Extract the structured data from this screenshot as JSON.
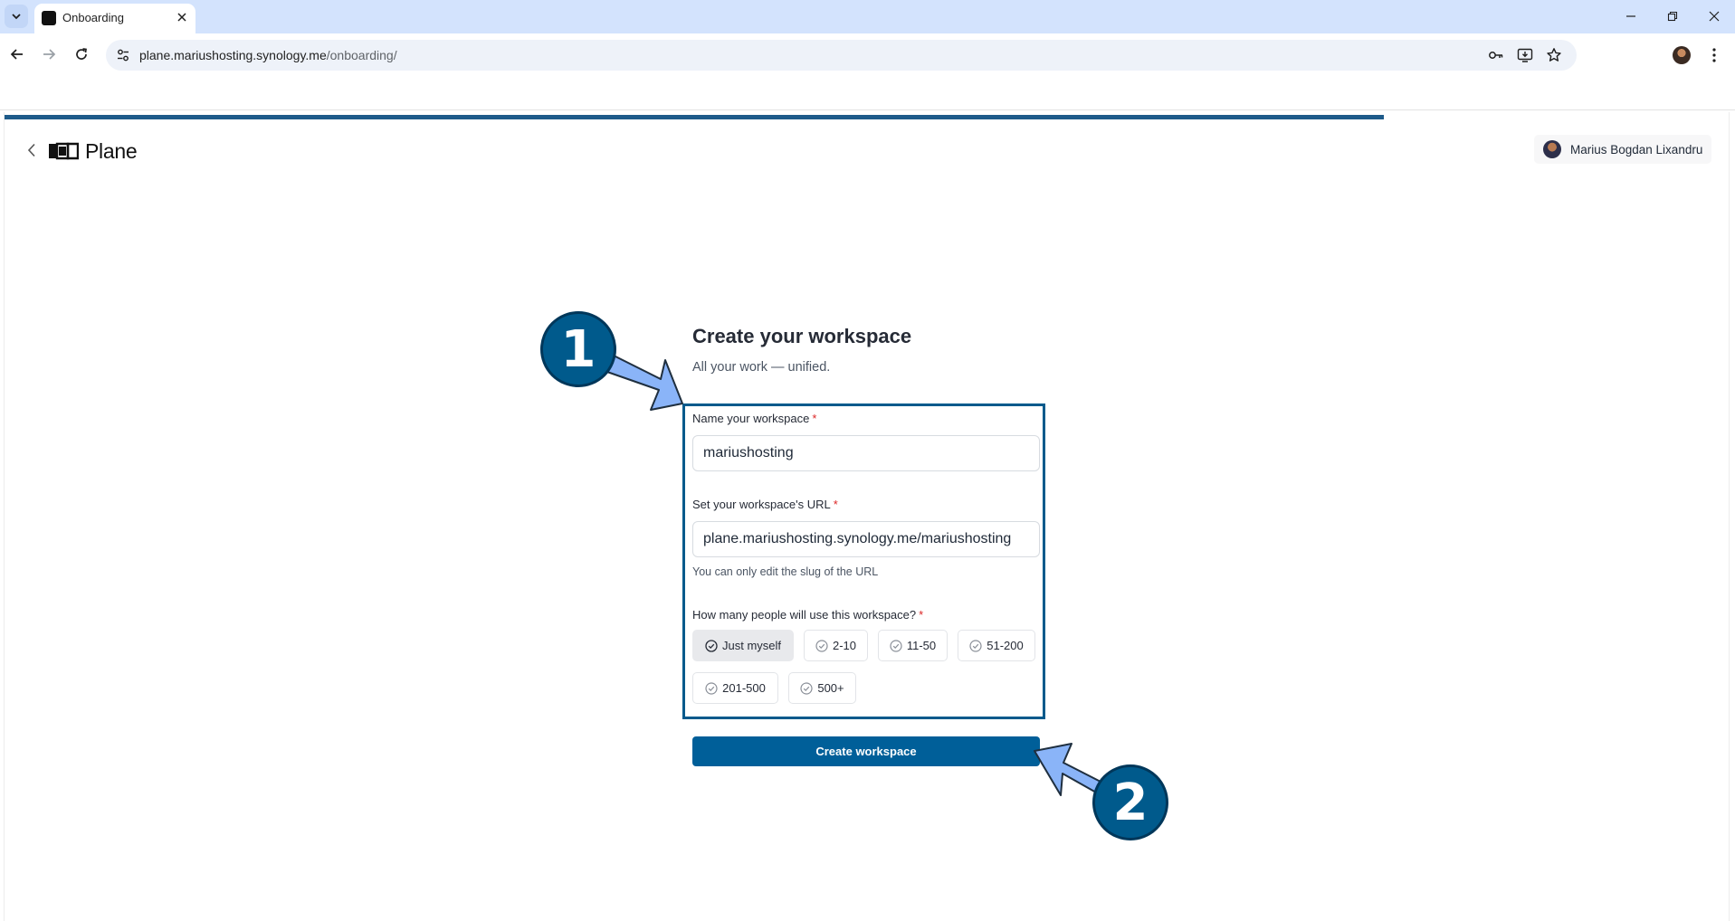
{
  "browser": {
    "tab_title": "Onboarding",
    "url_host": "plane.mariushosting.synology.me",
    "url_path": "/onboarding/"
  },
  "app": {
    "brand_name": "Plane",
    "user_name": "Marius Bogdan Lixandru",
    "progress_percent": 80
  },
  "form": {
    "title": "Create your workspace",
    "subtitle": "All your work — unified.",
    "name_label": "Name your workspace",
    "name_value": "mariushosting",
    "url_label": "Set your workspace's URL",
    "url_value": "plane.mariushosting.synology.me/mariushosting",
    "url_hint": "You can only edit the slug of the URL",
    "size_label": "How many people will use this workspace?",
    "required_marker": "*",
    "size_options": [
      "Just myself",
      "2-10",
      "11-50",
      "51-200",
      "201-500",
      "500+"
    ],
    "selected_size": "Just myself",
    "submit_label": "Create workspace"
  },
  "annotations": {
    "badge_1": "1",
    "badge_2": "2",
    "box_color": "#005a8c",
    "arrow_color": "#8ab4f8"
  }
}
